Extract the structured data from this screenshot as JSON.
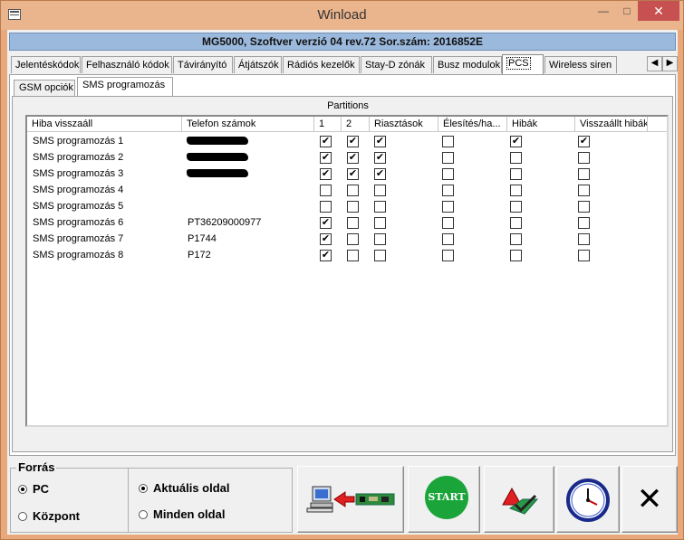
{
  "window": {
    "title": "Winload",
    "minimize_glyph": "—",
    "maximize_glyph": "□",
    "close_glyph": "✕"
  },
  "header": {
    "info": "MG5000, Szoftver verzió 04 rev.72 Sor.szám: 2016852E"
  },
  "tabs": [
    {
      "label": "Jelentéskódok"
    },
    {
      "label": "Felhasználó kódok"
    },
    {
      "label": "Távirányító"
    },
    {
      "label": "Átjátszók"
    },
    {
      "label": "Rádiós kezelők"
    },
    {
      "label": "Stay-D zónák"
    },
    {
      "label": "Busz modulok"
    },
    {
      "label": "PCS",
      "active": true
    },
    {
      "label": "Wireless siren"
    }
  ],
  "subtabs": [
    {
      "label": "GSM opciók"
    },
    {
      "label": "SMS programozás",
      "active": true
    }
  ],
  "grid": {
    "partitions_label": "Partitions",
    "headers": [
      "Hiba visszaáll",
      "Telefon számok",
      "1",
      "2",
      "Riasztások",
      "Élesítés/ha...",
      "Hibák",
      "Visszaállt hibák"
    ],
    "rows": [
      {
        "name": "SMS programozás 1",
        "phone": "",
        "redacted": true,
        "p1": true,
        "p2": true,
        "alarms": true,
        "arming": false,
        "faults": true,
        "restored": true
      },
      {
        "name": "SMS programozás 2",
        "phone": "",
        "redacted": true,
        "p1": true,
        "p2": true,
        "alarms": true,
        "arming": false,
        "faults": false,
        "restored": false
      },
      {
        "name": "SMS programozás 3",
        "phone": "",
        "redacted": true,
        "p1": true,
        "p2": true,
        "alarms": true,
        "arming": false,
        "faults": false,
        "restored": false
      },
      {
        "name": "SMS programozás 4",
        "phone": "",
        "redacted": false,
        "p1": false,
        "p2": false,
        "alarms": false,
        "arming": false,
        "faults": false,
        "restored": false
      },
      {
        "name": "SMS programozás 5",
        "phone": "",
        "redacted": false,
        "p1": false,
        "p2": false,
        "alarms": false,
        "arming": false,
        "faults": false,
        "restored": false
      },
      {
        "name": "SMS programozás 6",
        "phone": "PT36209000977",
        "redacted": false,
        "p1": true,
        "p2": false,
        "alarms": false,
        "arming": false,
        "faults": false,
        "restored": false
      },
      {
        "name": "SMS programozás 7",
        "phone": "P1744",
        "redacted": false,
        "p1": true,
        "p2": false,
        "alarms": false,
        "arming": false,
        "faults": false,
        "restored": false
      },
      {
        "name": "SMS programozás 8",
        "phone": "P172",
        "redacted": false,
        "p1": true,
        "p2": false,
        "alarms": false,
        "arming": false,
        "faults": false,
        "restored": false
      }
    ]
  },
  "source": {
    "title": "Forrás",
    "options": [
      {
        "label": "PC",
        "selected": true
      },
      {
        "label": "Központ",
        "selected": false
      }
    ],
    "page_options": [
      {
        "label": "Aktuális oldal",
        "selected": true
      },
      {
        "label": "Minden oldal",
        "selected": false
      }
    ]
  },
  "buttons": {
    "transfer_icon": "pc-to-panel-icon",
    "start_label": "START",
    "compare_icon": "compare-icon",
    "clock_icon": "clock-icon",
    "close_glyph": "✕"
  },
  "colors": {
    "title_bar": "#eab48c",
    "header_bar": "#9bb9dc",
    "start_green": "#1aa43a",
    "close_red": "#c75050"
  }
}
